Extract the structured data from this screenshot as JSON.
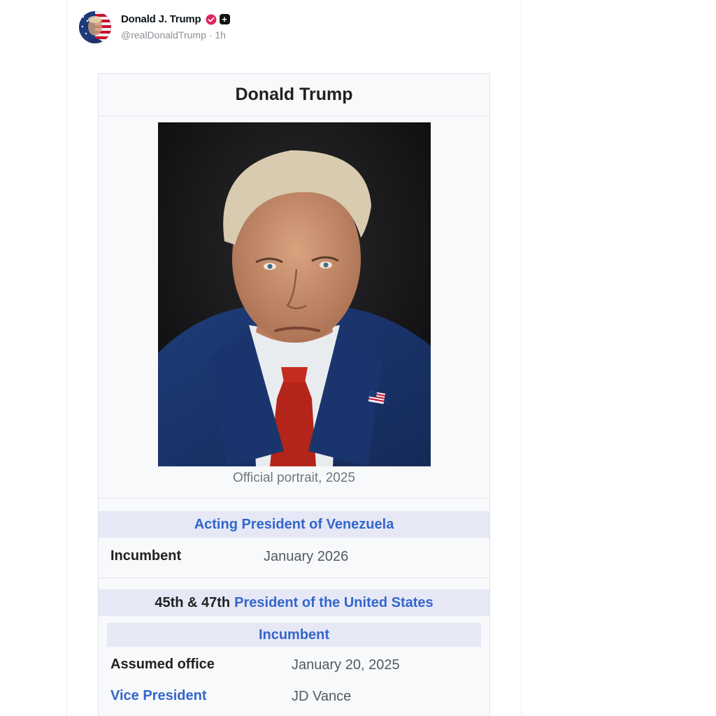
{
  "post": {
    "author": {
      "display_name": "Donald J. Trump",
      "handle": "@realDonaldTrump",
      "separator": "·",
      "time_ago": "1h",
      "avatar_icon": "flag-portrait-avatar",
      "verified_icon": "verified-badge-icon",
      "verified_color": "#e0245e"
    }
  },
  "infobox": {
    "title": "Donald Trump",
    "portrait_caption": "Official portrait, 2025",
    "venezuela": {
      "header": "Acting President of Venezuela",
      "incumbent_label": "Incumbent",
      "incumbent_value": "January 2026"
    },
    "us": {
      "header_prefix": "45th & 47th",
      "header_link": "President of the United States",
      "incumbent_subheader": "Incumbent",
      "assumed_label": "Assumed office",
      "assumed_value": "January 20, 2025",
      "vp_label": "Vice President",
      "vp_value": "JD Vance"
    },
    "colors": {
      "link_blue": "#3366cc",
      "header_bg": "#e6e8f6",
      "box_bg": "#f8f9fb"
    }
  }
}
